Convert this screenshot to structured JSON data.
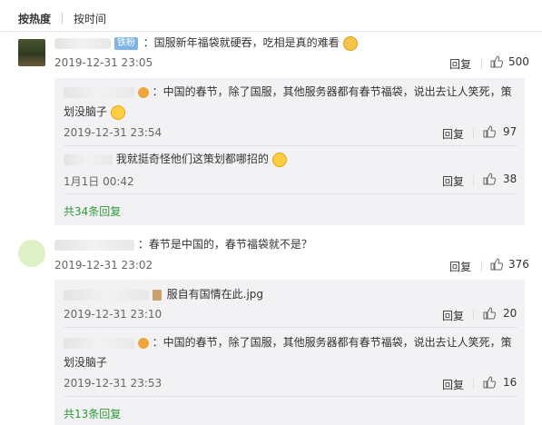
{
  "tabs": {
    "hot": "按热度",
    "time": "按时间"
  },
  "comments": [
    {
      "badge": "铁粉",
      "text": "：国服新年福袋就硬吞，吃相是真的难看",
      "time": "2019-12-31 23:05",
      "reply_label": "回复",
      "likes": "500",
      "replies": [
        {
          "text_line1": "：中国的春节，除了国服，其他服务器都有春节福袋，说出去让人笑死，策",
          "text_line2": "划没脑子",
          "time": "2019-12-31 23:54",
          "reply_label": "回复",
          "likes": "97"
        },
        {
          "text": "我就挺奇怪他们这策划都哪招的",
          "time": "1月1日 00:42",
          "reply_label": "回复",
          "likes": "38"
        }
      ],
      "more": "共34条回复"
    },
    {
      "text": "：春节是中国的，春节福袋就不是？",
      "time": "2019-12-31 23:02",
      "reply_label": "回复",
      "likes": "376",
      "replies": [
        {
          "text": "服自有国情在此.jpg",
          "time": "2019-12-31 23:10",
          "reply_label": "回复",
          "likes": "20"
        },
        {
          "text_line1": "：中国的春节，除了国服，其他服务器都有春节福袋，说出去让人笑死，策",
          "text_line2": "划没脑子",
          "time": "2019-12-31 23:53",
          "reply_label": "回复",
          "likes": "16"
        }
      ],
      "more": "共13条回复"
    }
  ],
  "colors": {
    "accent_green": "#2f9a3a",
    "badge_blue": "#7fb5e6",
    "reply_bg": "#f2f2f5"
  }
}
